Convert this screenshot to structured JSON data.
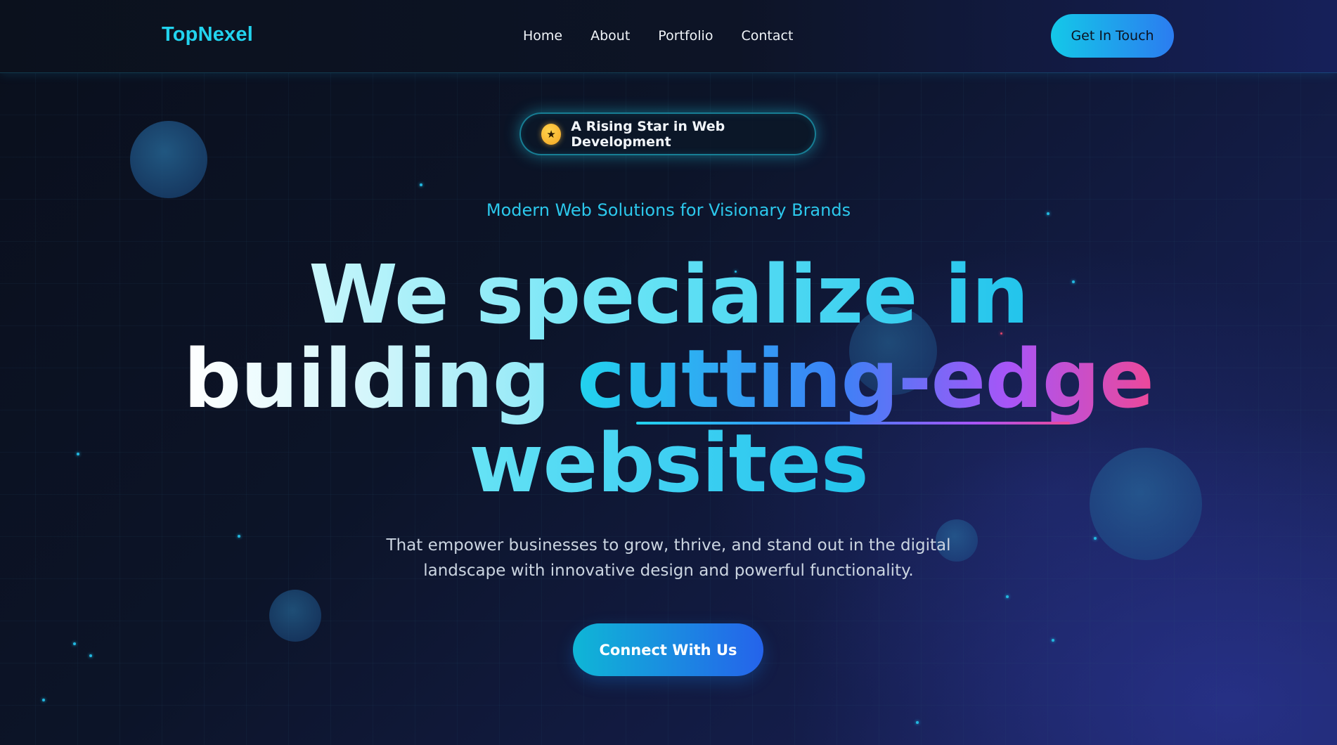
{
  "brand": {
    "name": "TopNexel",
    "accent_color": "#22d3ee"
  },
  "nav": {
    "links": [
      "Home",
      "About",
      "Portfolio",
      "Contact"
    ],
    "cta_label": "Get In Touch"
  },
  "hero": {
    "badge": {
      "icon": "star-icon",
      "icon_glyph": "★",
      "text": "A Rising Star in Web Development"
    },
    "subtitle": "Modern Web Solutions for Visionary Brands",
    "headline": {
      "line1": "We specialize in",
      "line2_plain": "building",
      "line2_accent": "cutting-edge",
      "line3": "websites"
    },
    "description": {
      "line1": "That empower businesses to grow, thrive, and stand out in the digital",
      "line2": "landscape with innovative design and powerful functionality."
    },
    "cta_label": "Connect With Us"
  },
  "colors": {
    "gradient_start": "#22d3ee",
    "gradient_mid": "#3b82f6",
    "gradient_purple": "#a855f7",
    "gradient_end": "#ec4899",
    "background": "#0a0f1c"
  }
}
